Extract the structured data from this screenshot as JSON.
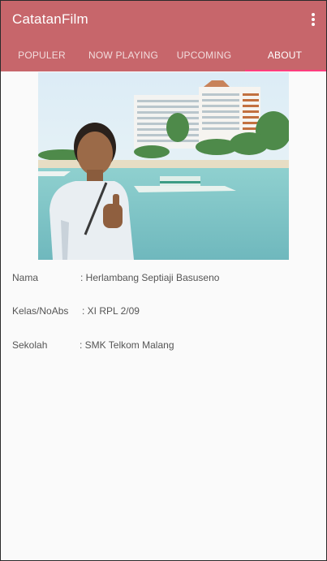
{
  "app": {
    "title": "CatatanFilm",
    "menu_icon": "more-vert-icon"
  },
  "tabs": [
    {
      "label": "POPULER"
    },
    {
      "label": "NOW PLAYING"
    },
    {
      "label": "UPCOMING"
    },
    {
      "label": "ABOUT"
    }
  ],
  "active_tab": "ABOUT",
  "colors": {
    "appbar": "#c7666b",
    "indicator": "#ff3d7f"
  },
  "profile": {
    "rows": [
      {
        "label": "Nama",
        "value": ": Herlambang Septiaji Basuseno"
      },
      {
        "label": "Kelas/NoAbs",
        "value": ": XI RPL 2/09"
      },
      {
        "label": "Sekolah",
        "value": ": SMK Telkom Malang"
      }
    ]
  }
}
